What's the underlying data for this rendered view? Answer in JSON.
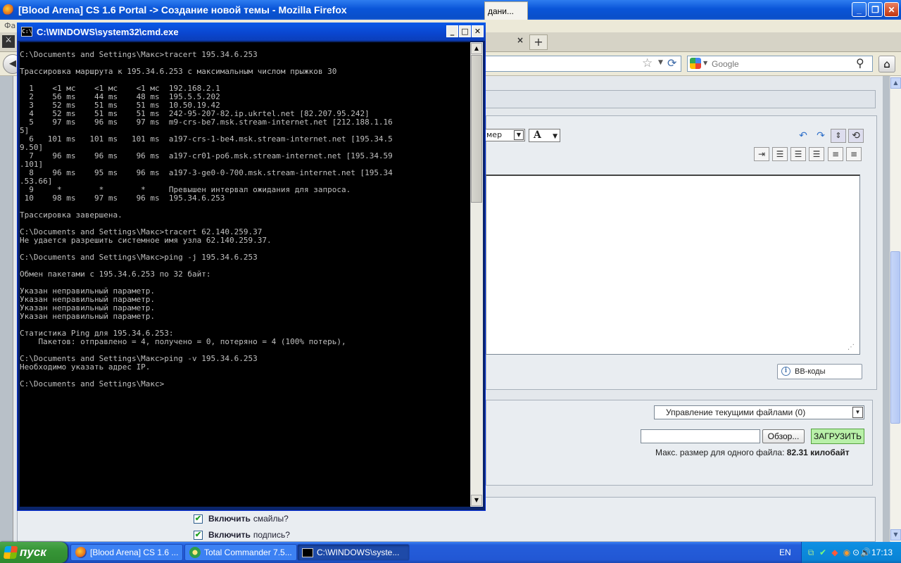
{
  "firefox": {
    "title": "[Blood Arena] CS 1.6 Portal -> Создание новой темы - Mozilla Firefox",
    "menu_fragment": "Фа",
    "active_tab_label": "дани...",
    "tab_close": "×",
    "new_tab": "+",
    "search_placeholder": "Google"
  },
  "editor": {
    "size_select_value": "мер",
    "font_color_label": "A",
    "bbcodes_label": "BB-коды"
  },
  "attachments": {
    "files_select_value": "Управление текущими файлами (0)",
    "browse_label": "Обзор...",
    "upload_label": "ЗАГРУЗИТЬ",
    "max_size_label": "Макс. размер для одного файла:",
    "max_size_value": "82.31 килобайт"
  },
  "options": {
    "smileys_bold": "Включить",
    "smileys_rest": "смайлы?",
    "signature_bold": "Включить",
    "signature_rest": "подпись?"
  },
  "cmd": {
    "title": "C:\\WINDOWS\\system32\\cmd.exe",
    "lines": [
      "C:\\Documents and Settings\\Макс>tracert 195.34.6.253",
      "",
      "Трассировка маршрута к 195.34.6.253 с максимальным числом прыжков 30",
      "",
      "  1    <1 мс    <1 мс    <1 мс  192.168.2.1",
      "  2    56 ms    44 ms    48 ms  195.5.5.202",
      "  3    52 ms    51 ms    51 ms  10.50.19.42",
      "  4    52 ms    51 ms    51 ms  242-95-207-82.ip.ukrtel.net [82.207.95.242]",
      "  5    97 ms    96 ms    97 ms  m9-crs-be7.msk.stream-internet.net [212.188.1.16",
      "5]",
      "  6   101 ms   101 ms   101 ms  a197-crs-1-be4.msk.stream-internet.net [195.34.5",
      "9.50]",
      "  7    96 ms    96 ms    96 ms  a197-cr01-po6.msk.stream-internet.net [195.34.59",
      ".101]",
      "  8    96 ms    95 ms    96 ms  a197-3-ge0-0-700.msk.stream-internet.net [195.34",
      ".53.66]",
      "  9     *        *        *     Превышен интервал ожидания для запроса.",
      " 10    98 ms    97 ms    96 ms  195.34.6.253",
      "",
      "Трассировка завершена.",
      "",
      "C:\\Documents and Settings\\Макс>tracert 62.140.259.37",
      "Не удается разрешить системное имя узла 62.140.259.37.",
      "",
      "C:\\Documents and Settings\\Макс>ping -j 195.34.6.253",
      "",
      "Обмен пакетами с 195.34.6.253 по 32 байт:",
      "",
      "Указан неправильный параметр.",
      "Указан неправильный параметр.",
      "Указан неправильный параметр.",
      "Указан неправильный параметр.",
      "",
      "Статистика Ping для 195.34.6.253:",
      "    Пакетов: отправлено = 4, получено = 0, потеряно = 4 (100% потерь),",
      "",
      "C:\\Documents and Settings\\Макс>ping -v 195.34.6.253",
      "Необходимо указать адрес IP.",
      "",
      "C:\\Documents and Settings\\Макс>"
    ]
  },
  "taskbar": {
    "start_label": "пуск",
    "tasks": [
      {
        "label": "[Blood Arena] CS 1.6 ..."
      },
      {
        "label": "Total Commander 7.5..."
      },
      {
        "label": "C:\\WINDOWS\\syste..."
      }
    ],
    "language": "EN",
    "clock": "17:13"
  },
  "colors": {
    "xp_blue": "#245edb",
    "cmd_background": "#000000",
    "cmd_text": "#c0c0c0",
    "upload_button": "#b8f0a8"
  }
}
